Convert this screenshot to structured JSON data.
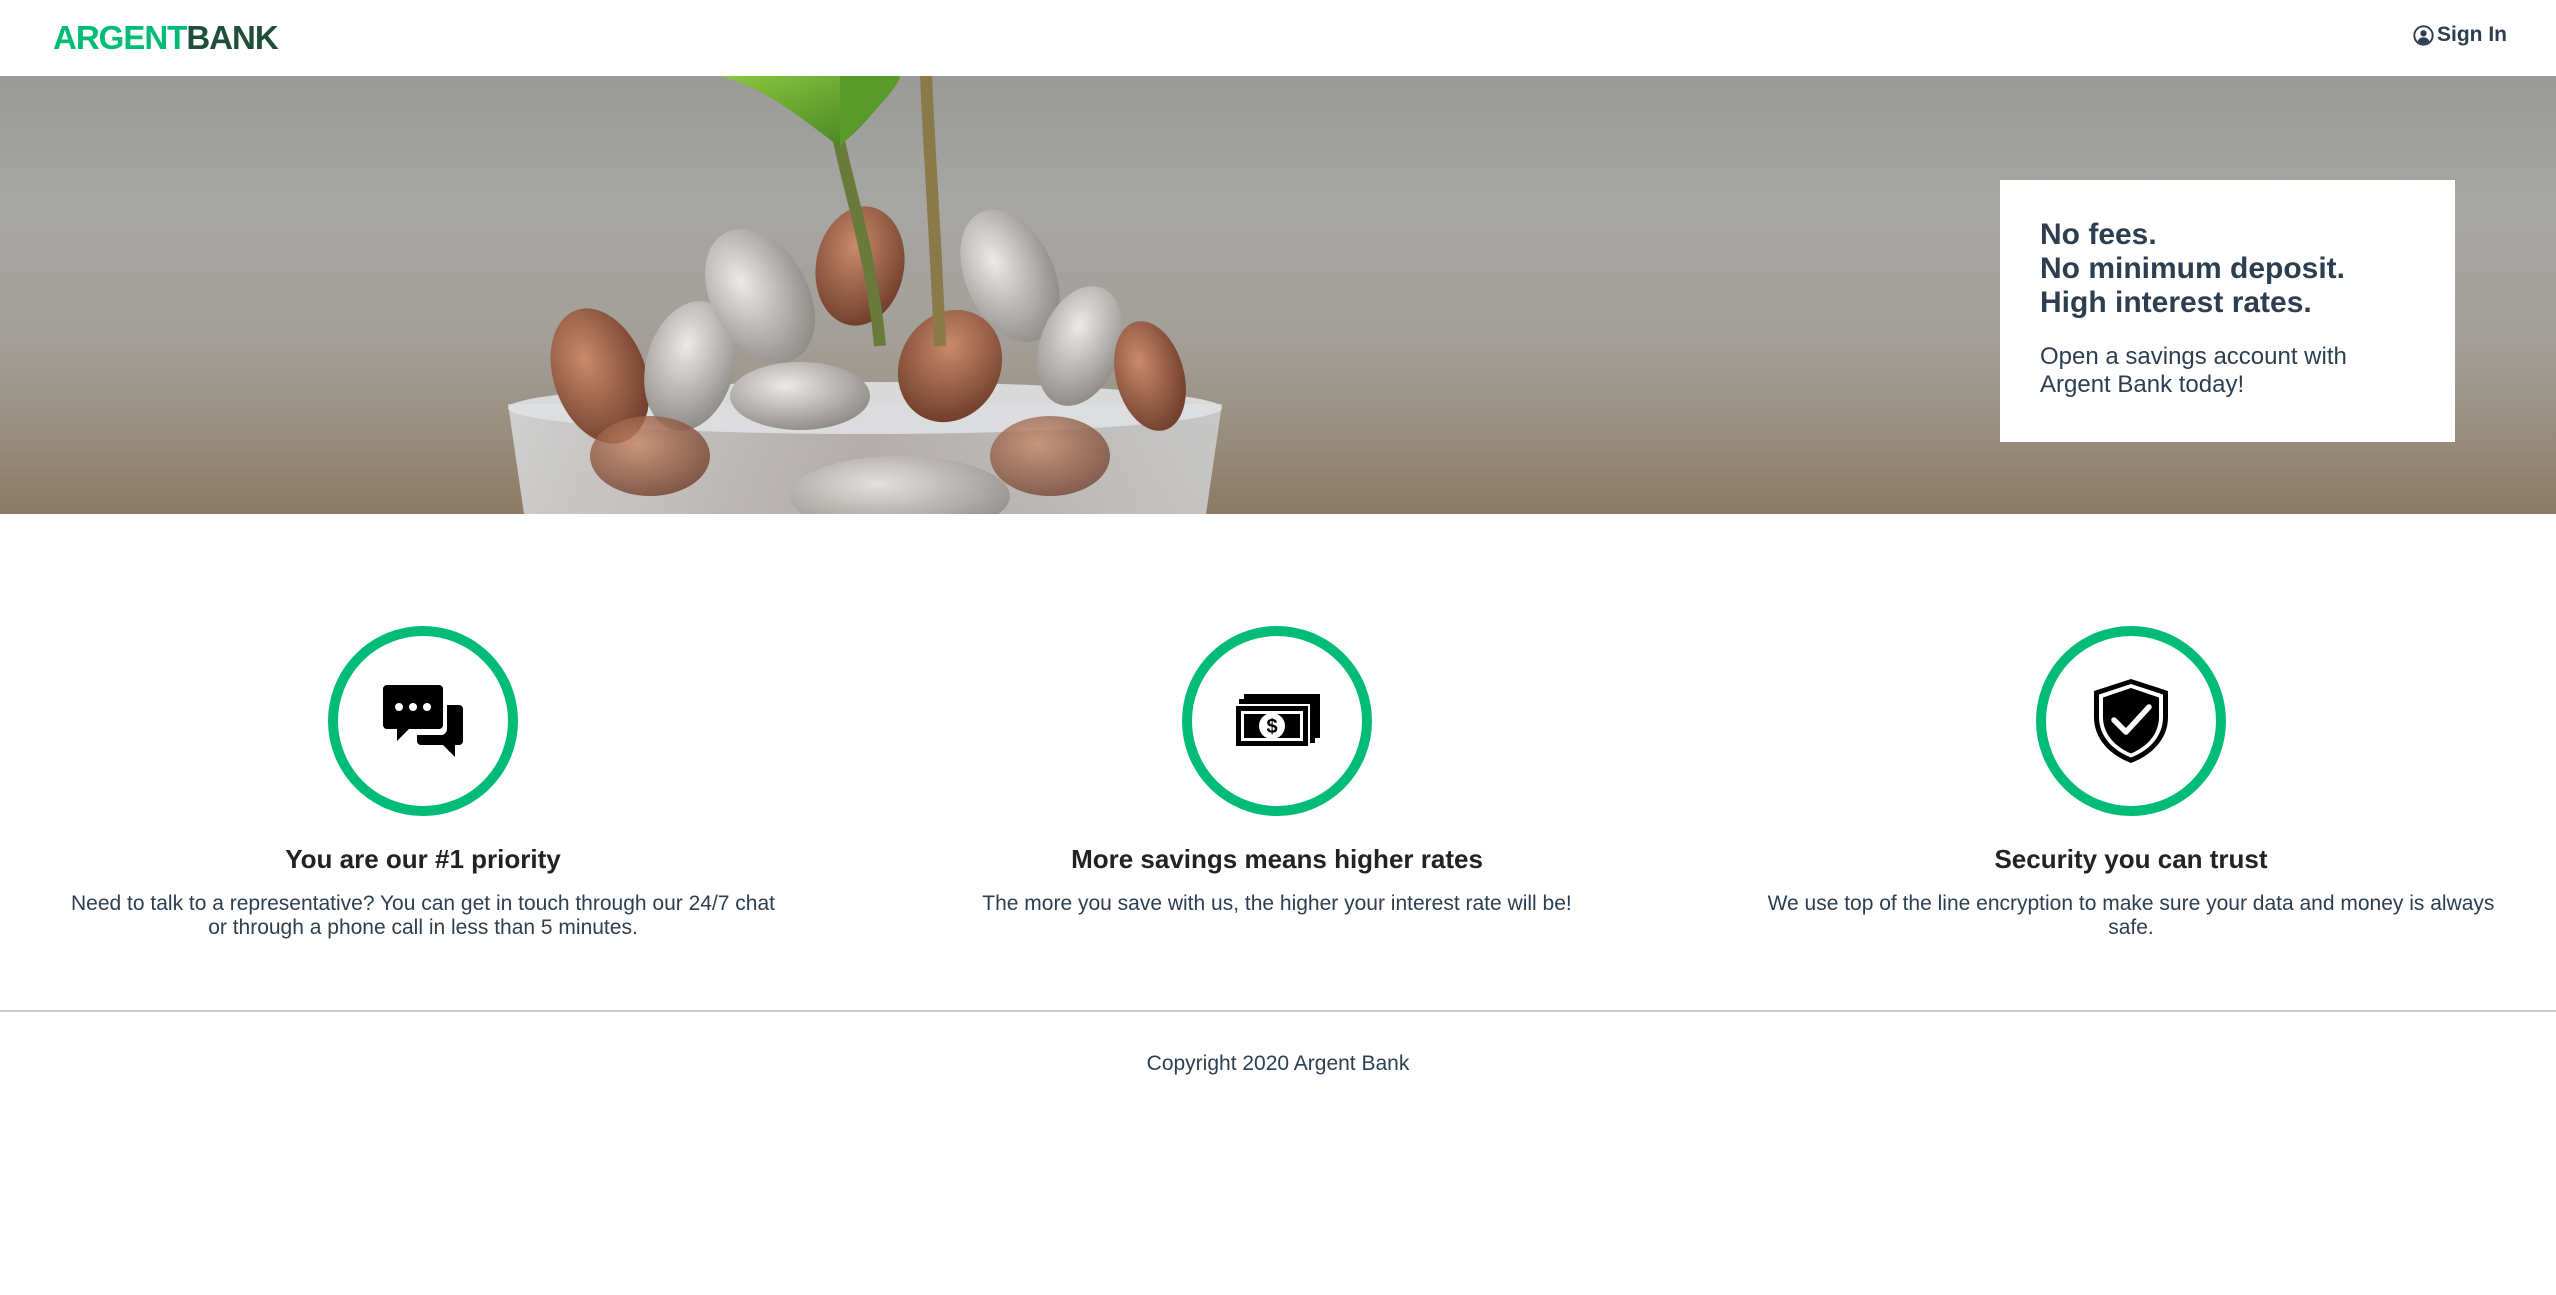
{
  "nav": {
    "logo_part1": "ARGENT",
    "logo_part2": "BANK",
    "signin_icon": "user-circle-icon",
    "signin_label": "Sign In"
  },
  "hero": {
    "subtitle_lines": [
      "No fees.",
      "No minimum deposit.",
      "High interest rates."
    ],
    "text": "Open a savings account with Argent Bank today!"
  },
  "features": [
    {
      "icon": "chat-icon",
      "title": "You are our #1 priority",
      "text": "Need to talk to a representative? You can get in touch through our 24/7 chat or through a phone call in less than 5 minutes."
    },
    {
      "icon": "money-icon",
      "title": "More savings means higher rates",
      "text": "The more you save with us, the higher your interest rate will be!"
    },
    {
      "icon": "security-shield-icon",
      "title": "Security you can trust",
      "text": "We use top of the line encryption to make sure your data and money is always safe."
    }
  ],
  "footer": {
    "copyright": "Copyright 2020 Argent Bank"
  },
  "colors": {
    "accent": "#00bc77",
    "brand_dark": "#1f4f3b",
    "text": "#2c3e50"
  }
}
